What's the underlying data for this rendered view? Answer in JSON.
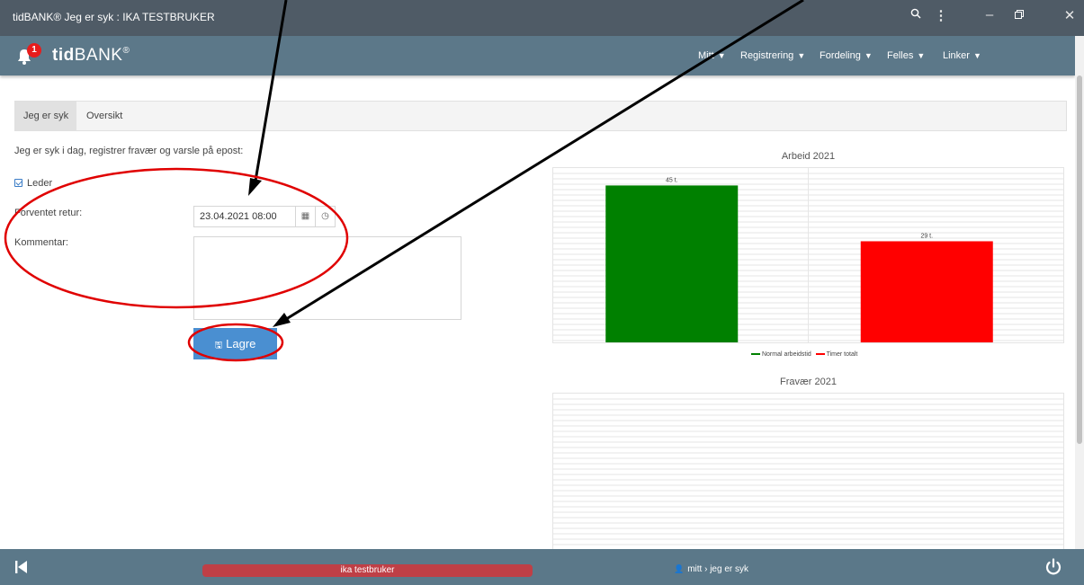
{
  "window": {
    "title": "tidBANK® Jeg er syk : IKA TESTBRUKER"
  },
  "header": {
    "notification_count": "1",
    "logo_bold": "tid",
    "logo_rest": "BANK",
    "logo_mark": "®",
    "menu": [
      {
        "label": "Mitt"
      },
      {
        "label": "Registrering"
      },
      {
        "label": "Fordeling"
      },
      {
        "label": "Felles"
      },
      {
        "label": "Linker"
      }
    ]
  },
  "tabs": [
    {
      "label": "Jeg er syk"
    },
    {
      "label": "Oversikt"
    }
  ],
  "form": {
    "intro": "Jeg er syk i dag, registrer fravær og varsle på epost:",
    "leader_label": "Leder",
    "leader_checked": true,
    "return_label": "Forventet retur:",
    "return_value": "23.04.2021 08:00",
    "comment_label": "Kommentar:",
    "comment_value": "",
    "save_label": "Lagre"
  },
  "chart_data": [
    {
      "type": "bar",
      "title": "Arbeid 2021",
      "categories": [
        "",
        ""
      ],
      "series": [
        {
          "name": "Normal arbeidstid",
          "values": [
            45
          ],
          "color": "#008000",
          "label": "45 t."
        },
        {
          "name": "Timer totalt",
          "values": [
            29
          ],
          "color": "#ff0000",
          "label": "29 t."
        }
      ],
      "ylim": [
        0,
        50
      ],
      "grid": true,
      "legend_position": "bottom"
    },
    {
      "type": "bar",
      "title": "Fravær 2021",
      "series": [],
      "grid": true
    }
  ],
  "footer": {
    "user": "ika testbruker",
    "breadcrumb": "mitt › jeg er syk"
  },
  "colors": {
    "titlebar": "#4f5b66",
    "header": "#5c7889",
    "primary_button": "#4a8fd1",
    "user_pill": "#bf3f46",
    "annotation": "#e00000"
  }
}
